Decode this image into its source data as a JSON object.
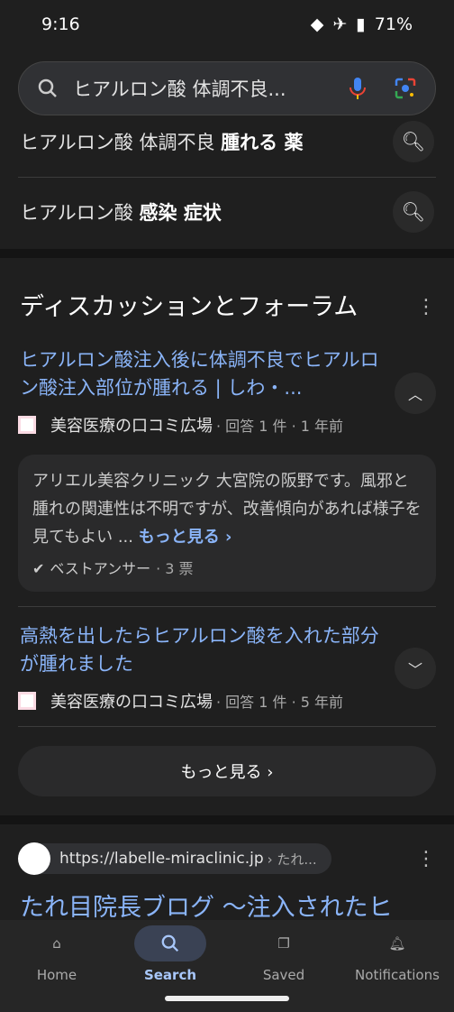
{
  "status": {
    "time": "9:16",
    "battery": "71%"
  },
  "search": {
    "query": "ヒアルロン酸 体調不良..."
  },
  "suggestions": [
    {
      "plain": "ヒアルロン酸 体調不良 ",
      "bold": "腫れる 薬"
    },
    {
      "plain": "ヒアルロン酸 ",
      "bold": "感染 症状"
    }
  ],
  "discussions": {
    "title": "ディスカッションとフォーラム",
    "items": [
      {
        "title": "ヒアルロン酸注入後に体調不良でヒアルロン酸注入部位が腫れる | しわ・...",
        "source": "美容医療の口コミ広場",
        "meta": "· 回答 1 件 · 1 年前",
        "expanded": true,
        "answer": "アリエル美容クリニック 大宮院の阪野です。風邪と腫れの関連性は不明ですが、改善傾向があれば様子を見てもよい ...",
        "more": "もっと見る ›",
        "best": "ベストアンサー",
        "votes": "· 3 票"
      },
      {
        "title": "高熱を出したらヒアルロン酸を入れた部分が腫れました",
        "source": "美容医療の口コミ広場",
        "meta": "· 回答 1 件 · 5 年前",
        "expanded": false
      }
    ],
    "more_button": "もっと見る ›"
  },
  "result": {
    "url": "https://labelle-miraclinic.jp",
    "crumb": "› たれ...",
    "title": "たれ目院長ブログ 〜注入されたヒ"
  },
  "nav": [
    {
      "label": "Home"
    },
    {
      "label": "Search",
      "active": true
    },
    {
      "label": "Saved"
    },
    {
      "label": "Notifications"
    }
  ],
  "colors": {
    "link": "#8ab4f8",
    "background": "#1f1f1f"
  }
}
